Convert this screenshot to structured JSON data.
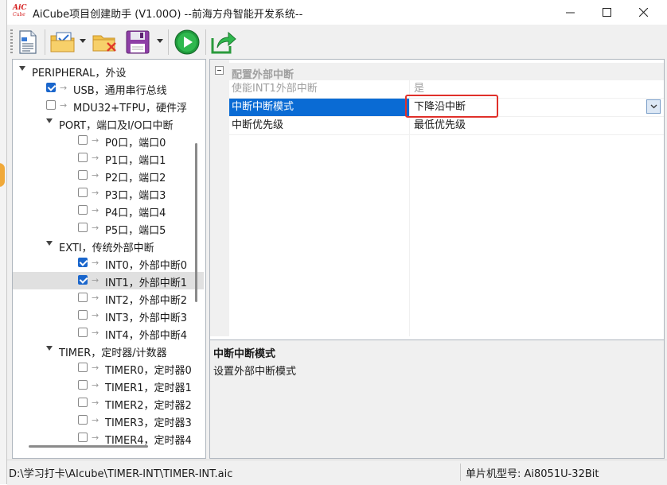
{
  "window": {
    "title": "AiCube项目创建助手 (V1.00O) --前海方舟智能开发系统--",
    "logo_top": "AiC",
    "logo_bottom": "Cube"
  },
  "toolbar": {
    "buttons": [
      {
        "name": "new-document",
        "icon": "document-icon"
      },
      {
        "name": "open-folder",
        "icon": "folder-check-icon",
        "has_dropdown": true
      },
      {
        "name": "close-folder",
        "icon": "folder-x-icon"
      },
      {
        "name": "save",
        "icon": "floppy-icon",
        "has_dropdown": true
      },
      {
        "name": "run",
        "icon": "play-icon"
      },
      {
        "name": "export",
        "icon": "share-arrow-icon"
      }
    ]
  },
  "tree": {
    "items": [
      {
        "label": "PERIPHERAL，外设",
        "level": 0,
        "expanded": true
      },
      {
        "label": "USB，通用串行总线",
        "level": 1,
        "checked": true
      },
      {
        "label": "MDU32+TFPU，硬件浮",
        "level": 1,
        "checked": false
      },
      {
        "label": "PORT，端口及I/O口中断",
        "level": 1,
        "expanded": true
      },
      {
        "label": "P0口，端口0",
        "level": 2,
        "checked": false
      },
      {
        "label": "P1口，端口1",
        "level": 2,
        "checked": false
      },
      {
        "label": "P2口，端口2",
        "level": 2,
        "checked": false
      },
      {
        "label": "P3口，端口3",
        "level": 2,
        "checked": false
      },
      {
        "label": "P4口，端口4",
        "level": 2,
        "checked": false
      },
      {
        "label": "P5口，端口5",
        "level": 2,
        "checked": false
      },
      {
        "label": "EXTI，传统外部中断",
        "level": 1,
        "expanded": true
      },
      {
        "label": "INT0，外部中断0",
        "level": 2,
        "checked": true
      },
      {
        "label": "INT1，外部中断1",
        "level": 2,
        "checked": true,
        "selected": true
      },
      {
        "label": "INT2，外部中断2",
        "level": 2,
        "checked": false
      },
      {
        "label": "INT3，外部中断3",
        "level": 2,
        "checked": false
      },
      {
        "label": "INT4，外部中断4",
        "level": 2,
        "checked": false
      },
      {
        "label": "TIMER，定时器/计数器",
        "level": 1,
        "expanded": true
      },
      {
        "label": "TIMER0，定时器0",
        "level": 2,
        "checked": false
      },
      {
        "label": "TIMER1，定时器1",
        "level": 2,
        "checked": false
      },
      {
        "label": "TIMER2，定时器2",
        "level": 2,
        "checked": false
      },
      {
        "label": "TIMER3，定时器3",
        "level": 2,
        "checked": false
      },
      {
        "label": "TIMER4，定时器4",
        "level": 2,
        "checked": false
      }
    ]
  },
  "property_grid": {
    "category": "配置外部中断",
    "rows": [
      {
        "name": "使能INT1外部中断",
        "value": "是"
      },
      {
        "name": "中断中断模式",
        "value": "下降沿中断"
      },
      {
        "name": "中断优先级",
        "value": "最低优先级"
      }
    ],
    "description_title": "中断中断模式",
    "description_text": "设置外部中断模式"
  },
  "statusbar": {
    "path": "D:\\学习打卡\\AIcube\\TIMER-INT\\TIMER-INT.aic",
    "model": "单片机型号:  Ai8051U-32Bit"
  },
  "colors": {
    "selection": "#0a6bd4",
    "check": "#1a66cc",
    "highlight_box": "#e0302a"
  }
}
